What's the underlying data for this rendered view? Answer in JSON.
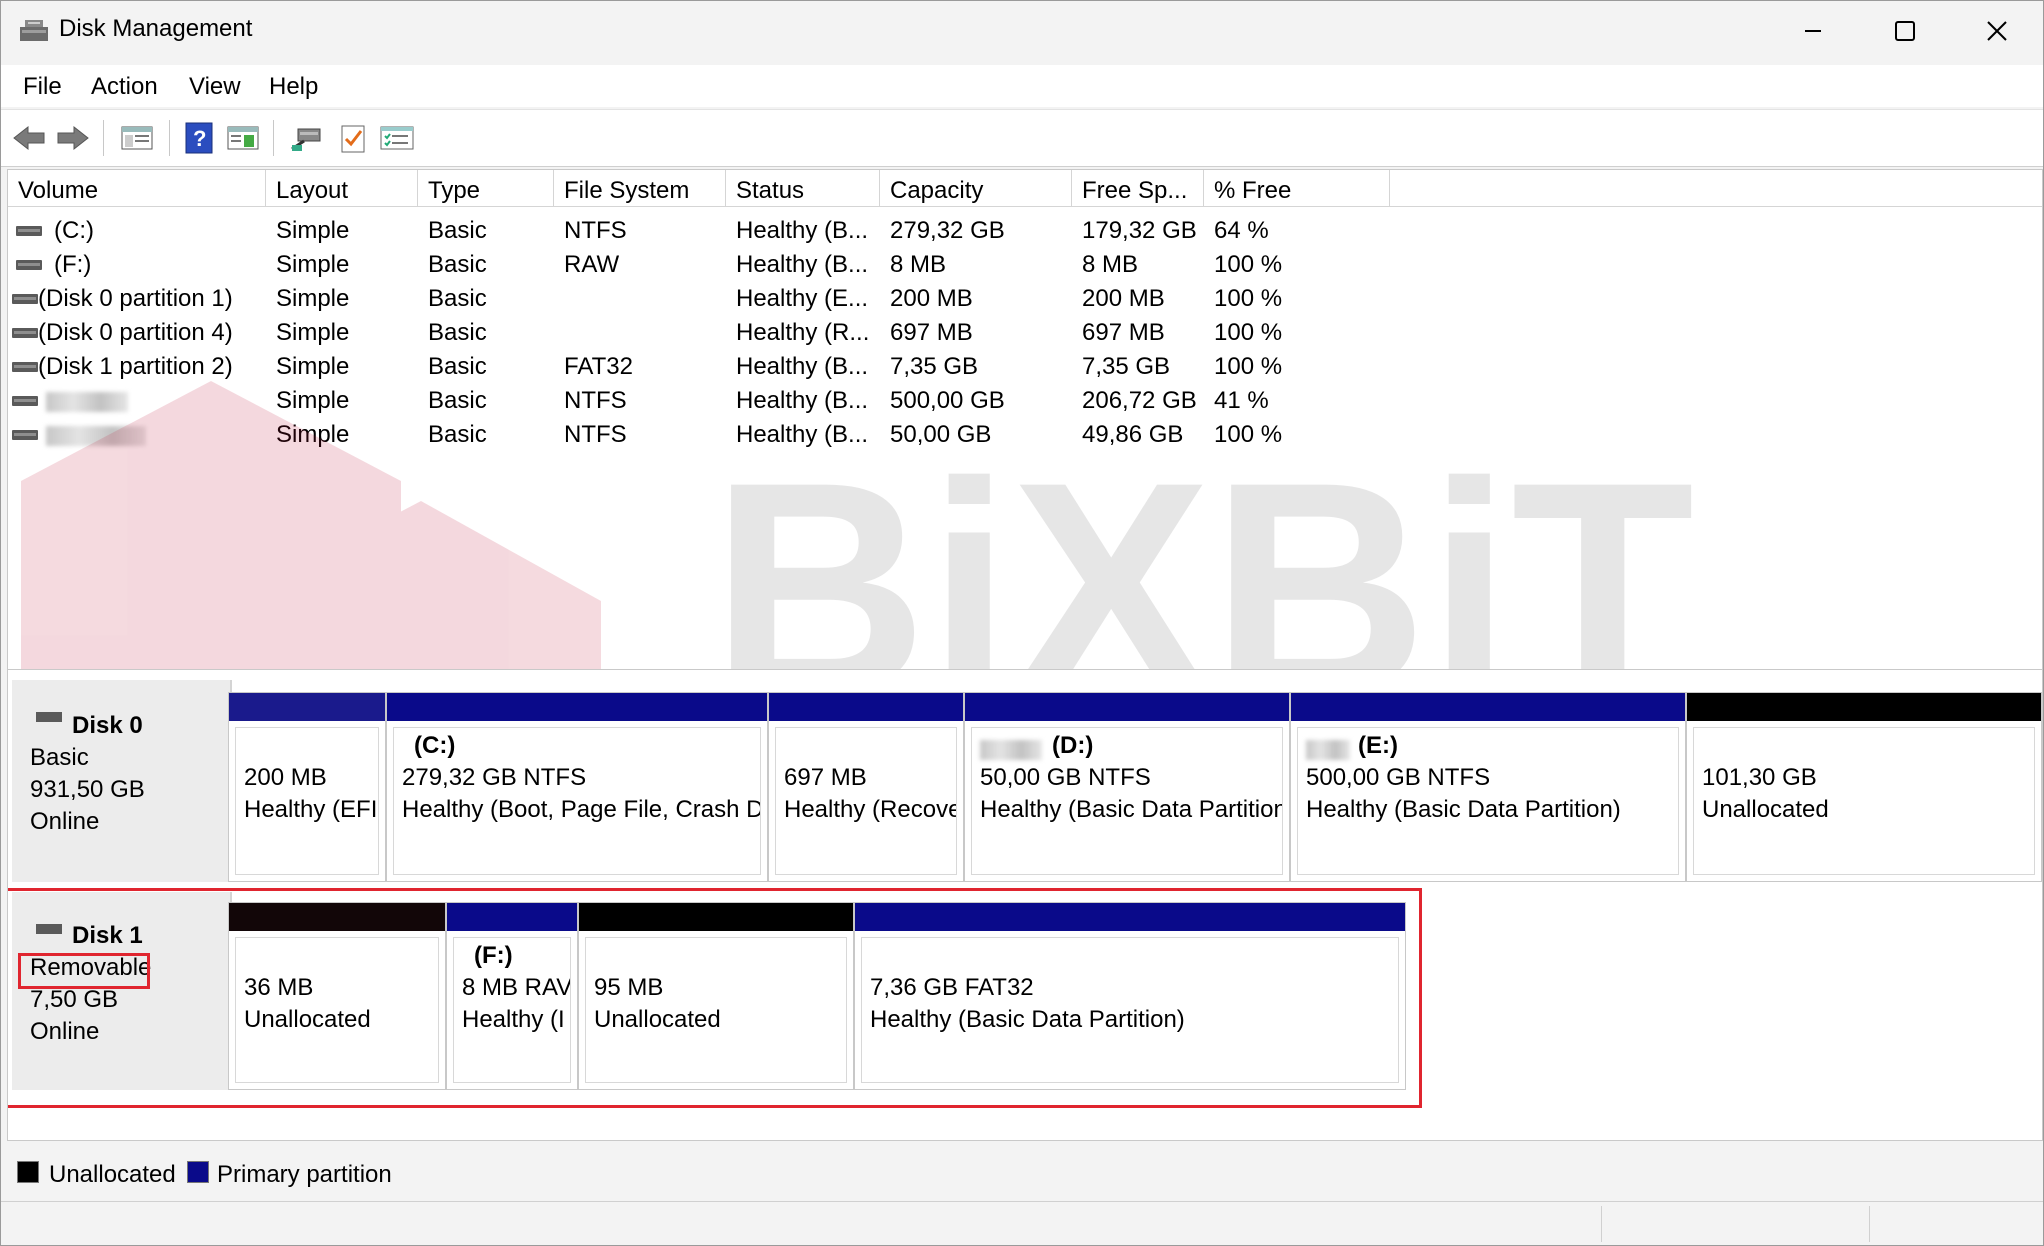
{
  "window": {
    "title": "Disk Management"
  },
  "menu": [
    {
      "label": "File"
    },
    {
      "label": "Action"
    },
    {
      "label": "View"
    },
    {
      "label": "Help"
    }
  ],
  "toolbar": [
    "back-icon",
    "forward-icon",
    "console-tree-icon",
    "help-icon",
    "properties-icon",
    "connect-icon",
    "checklist-icon",
    "settings-list-icon"
  ],
  "columns": [
    "Volume",
    "Layout",
    "Type",
    "File System",
    "Status",
    "Capacity",
    "Free Sp...",
    "% Free"
  ],
  "volumes": [
    {
      "name": "(C:)",
      "layout": "Simple",
      "type": "Basic",
      "fs": "NTFS",
      "status": "Healthy (B...",
      "capacity": "279,32 GB",
      "free": "179,32 GB",
      "pct": "64 %"
    },
    {
      "name": "(F:)",
      "layout": "Simple",
      "type": "Basic",
      "fs": "RAW",
      "status": "Healthy (B...",
      "capacity": "8 MB",
      "free": "8 MB",
      "pct": "100 %"
    },
    {
      "name": "(Disk 0 partition 1)",
      "layout": "Simple",
      "type": "Basic",
      "fs": "",
      "status": "Healthy (E...",
      "capacity": "200 MB",
      "free": "200 MB",
      "pct": "100 %"
    },
    {
      "name": "(Disk 0 partition 4)",
      "layout": "Simple",
      "type": "Basic",
      "fs": "",
      "status": "Healthy (R...",
      "capacity": "697 MB",
      "free": "697 MB",
      "pct": "100 %"
    },
    {
      "name": "(Disk 1 partition 2)",
      "layout": "Simple",
      "type": "Basic",
      "fs": "FAT32",
      "status": "Healthy (B...",
      "capacity": "7,35 GB",
      "free": "7,35 GB",
      "pct": "100 %"
    },
    {
      "name": "",
      "layout": "Simple",
      "type": "Basic",
      "fs": "NTFS",
      "status": "Healthy (B...",
      "capacity": "500,00 GB",
      "free": "206,72 GB",
      "pct": "41 %"
    },
    {
      "name": "",
      "layout": "Simple",
      "type": "Basic",
      "fs": "NTFS",
      "status": "Healthy (B...",
      "capacity": "50,00 GB",
      "free": "49,86 GB",
      "pct": "100 %"
    }
  ],
  "disks": [
    {
      "name": "Disk 0",
      "kind": "Basic",
      "size": "931,50 GB",
      "state": "Online",
      "partitions": [
        {
          "title": "",
          "line1": "200 MB",
          "line2": "Healthy (EFI",
          "color": "#1a1a8c"
        },
        {
          "title": "(C:)",
          "line1": "279,32 GB NTFS",
          "line2": "Healthy (Boot, Page File, Crash D",
          "color": "#0a0a8a"
        },
        {
          "title": "",
          "line1": "697 MB",
          "line2": "Healthy (Recove",
          "color": "#0a0a8a"
        },
        {
          "title": "(D:)",
          "line1": "50,00 GB NTFS",
          "line2": "Healthy (Basic Data Partition",
          "color": "#0a0a8a"
        },
        {
          "title": "(E:)",
          "line1": "500,00 GB NTFS",
          "line2": "Healthy (Basic Data Partition)",
          "color": "#0a0a8a"
        },
        {
          "title": "",
          "line1": "101,30 GB",
          "line2": "Unallocated",
          "color": "#000000"
        }
      ]
    },
    {
      "name": "Disk 1",
      "kind": "Removable",
      "size": "7,50 GB",
      "state": "Online",
      "partitions": [
        {
          "title": "",
          "line1": "36 MB",
          "line2": "Unallocated",
          "color": "#120608"
        },
        {
          "title": "(F:)",
          "line1": "8 MB RAV",
          "line2": "Healthy (I",
          "color": "#0a0a8a"
        },
        {
          "title": "",
          "line1": "95 MB",
          "line2": "Unallocated",
          "color": "#000000"
        },
        {
          "title": "",
          "line1": "7,36 GB FAT32",
          "line2": "Healthy (Basic Data Partition)",
          "color": "#0a0a8a"
        }
      ]
    }
  ],
  "legend": [
    {
      "label": "Unallocated",
      "color": "#000000"
    },
    {
      "label": "Primary partition",
      "color": "#0a0a8a"
    }
  ],
  "watermark": {
    "text": "BiXBiT"
  }
}
